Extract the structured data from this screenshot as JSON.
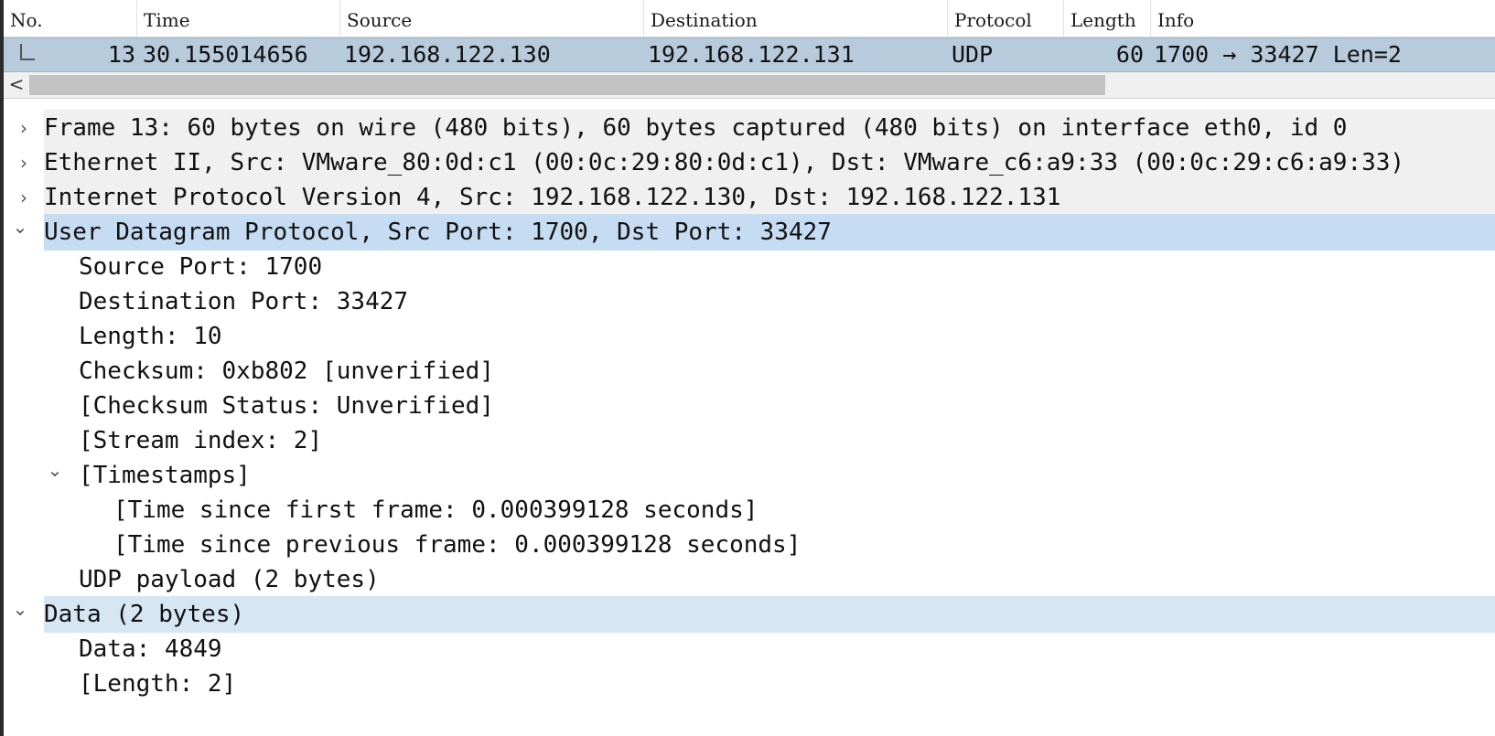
{
  "packet_list": {
    "columns": [
      "No.",
      "Time",
      "Source",
      "Destination",
      "Protocol",
      "Length",
      "Info"
    ],
    "row": {
      "no": "13",
      "time": "30.155014656",
      "source": "192.168.122.130",
      "destination": "192.168.122.131",
      "protocol": "UDP",
      "length": "60",
      "info": "1700 → 33427 Len=2"
    }
  },
  "scrollbar": {
    "left_arrow": "<"
  },
  "icons": {
    "collapsed": "›",
    "expanded": "⌄",
    "scroll_left": "chevron-left-icon"
  },
  "details": {
    "frame": "Frame 13: 60 bytes on wire (480 bits), 60 bytes captured (480 bits) on interface eth0, id 0",
    "ethernet": "Ethernet II, Src: VMware_80:0d:c1 (00:0c:29:80:0d:c1), Dst: VMware_c6:a9:33 (00:0c:29:c6:a9:33)",
    "ip": "Internet Protocol Version 4, Src: 192.168.122.130, Dst: 192.168.122.131",
    "udp": {
      "title": "User Datagram Protocol, Src Port: 1700, Dst Port: 33427",
      "source_port": "Source Port: 1700",
      "destination_port": "Destination Port: 33427",
      "length": "Length: 10",
      "checksum": "Checksum: 0xb802 [unverified]",
      "checksum_status": "[Checksum Status: Unverified]",
      "stream_index": "[Stream index: 2]",
      "timestamps": {
        "title": "[Timestamps]",
        "since_first": "[Time since first frame: 0.000399128 seconds]",
        "since_previous": "[Time since previous frame: 0.000399128 seconds]"
      },
      "payload": "UDP payload (2 bytes)"
    },
    "data": {
      "title": "Data (2 bytes)",
      "data": "Data: 4849",
      "length": "[Length: 2]"
    }
  },
  "colors": {
    "packet_row_bg": "#b8cbdc",
    "selected_tree_row": "#c6dcf2",
    "secondary_tree_row": "#d7e6f3",
    "shaded_tree_row": "#f0f0f0"
  }
}
